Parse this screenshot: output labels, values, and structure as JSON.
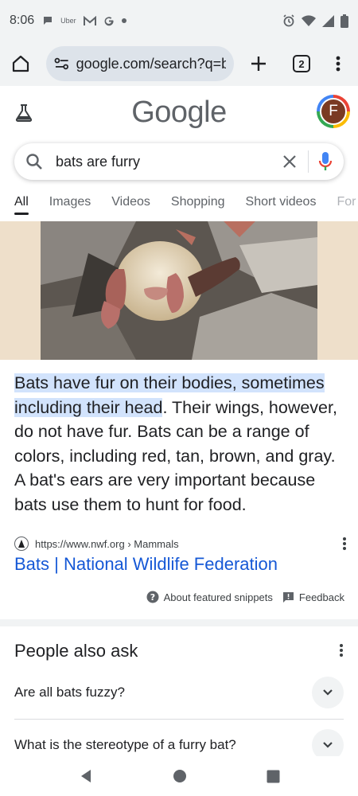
{
  "status_bar": {
    "time": "8:06",
    "notification_icons": [
      "chat-bubble-icon",
      "uber-icon",
      "gmail-icon",
      "google-g-icon",
      "dot-icon"
    ],
    "uber_label": "Uber",
    "right_icons": [
      "alarm-icon",
      "wifi-icon",
      "signal-icon",
      "battery-icon"
    ]
  },
  "browser": {
    "url": "google.com/search?q=b",
    "tab_count": "2"
  },
  "header": {
    "logo": "Google",
    "avatar_letter": "F"
  },
  "search": {
    "query": "bats are furry"
  },
  "tabs": [
    {
      "label": "All",
      "active": true
    },
    {
      "label": "Images"
    },
    {
      "label": "Videos"
    },
    {
      "label": "Shopping"
    },
    {
      "label": "Short videos"
    },
    {
      "label": "For"
    }
  ],
  "featured_snippet": {
    "highlight": "Bats have fur on their bodies, sometimes including their head",
    "rest": ". Their wings, however, do not have fur. Bats can be a range of colors, including red, tan, brown, and gray. A bat's ears are very important because bats use them to hunt for food.",
    "source_url": "https://www.nwf.org › Mammals",
    "link_title": "Bats | National Wildlife Federation",
    "about_label": "About featured snippets",
    "feedback_label": "Feedback"
  },
  "people_also_ask": {
    "title": "People also ask",
    "questions": [
      "Are all bats fuzzy?",
      "What is the stereotype of a furry bat?"
    ]
  },
  "colors": {
    "link": "#1558d6",
    "highlight": "#d2e3fc",
    "browser_chrome": "#f1f3f4"
  }
}
